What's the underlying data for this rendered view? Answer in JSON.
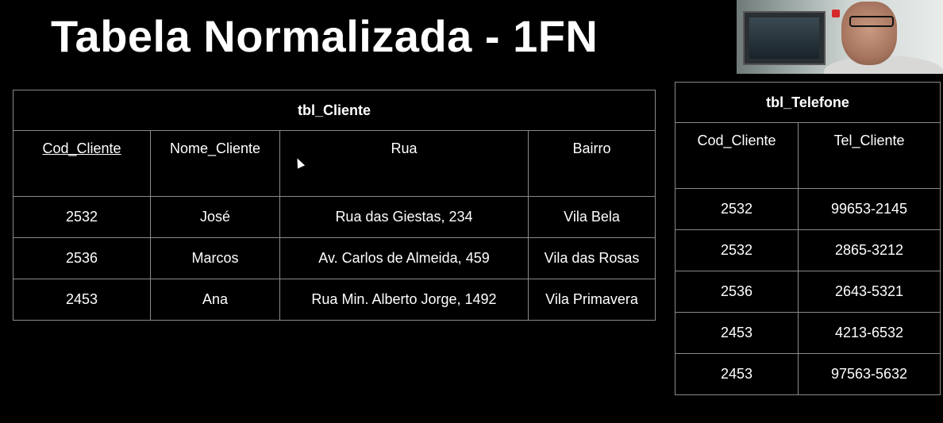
{
  "slide": {
    "title": "Tabela Normalizada - 1FN"
  },
  "tbl_cliente": {
    "name": "tbl_Cliente",
    "headers": [
      "Cod_Cliente",
      "Nome_Cliente",
      "Rua",
      "Bairro"
    ],
    "rows": [
      [
        "2532",
        "José",
        "Rua das Giestas, 234",
        "Vila Bela"
      ],
      [
        "2536",
        "Marcos",
        "Av. Carlos de Almeida, 459",
        "Vila das Rosas"
      ],
      [
        "2453",
        "Ana",
        "Rua Min. Alberto Jorge, 1492",
        "Vila Primavera"
      ]
    ]
  },
  "tbl_telefone": {
    "name": "tbl_Telefone",
    "headers": [
      "Cod_Cliente",
      "Tel_Cliente"
    ],
    "rows": [
      [
        "2532",
        "99653-2145"
      ],
      [
        "2532",
        "2865-3212"
      ],
      [
        "2536",
        "2643-5321"
      ],
      [
        "2453",
        "4213-6532"
      ],
      [
        "2453",
        "97563-5632"
      ]
    ]
  },
  "colors": {
    "background": "#000000",
    "text": "#ffffff",
    "border": "#8a8a8a"
  }
}
